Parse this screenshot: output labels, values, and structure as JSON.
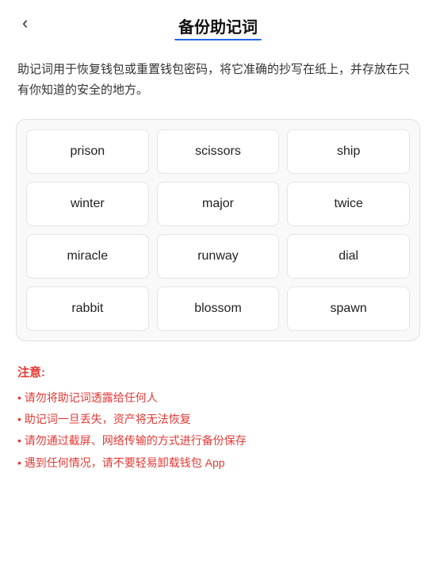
{
  "header": {
    "back_label": "‹",
    "title": "备份助记词"
  },
  "description": "助记词用于恢复钱包或重置钱包密码，将它准确的抄写在纸上，并存放在只有你知道的安全的地方。",
  "mnemonic_grid": {
    "cells": [
      {
        "word": "prison"
      },
      {
        "word": "scissors"
      },
      {
        "word": "ship"
      },
      {
        "word": "winter"
      },
      {
        "word": "major"
      },
      {
        "word": "twice"
      },
      {
        "word": "miracle"
      },
      {
        "word": "runway"
      },
      {
        "word": "dial"
      },
      {
        "word": "rabbit"
      },
      {
        "word": "blossom"
      },
      {
        "word": "spawn"
      }
    ]
  },
  "notice": {
    "title": "注意:",
    "items": [
      "请勿将助记词透露给任何人",
      "助记词一旦丢失，资产将无法恢复",
      "请勿通过截屏、网络传输的方式进行备份保存",
      "遇到任何情况，请不要轻易卸载钱包 App"
    ]
  }
}
